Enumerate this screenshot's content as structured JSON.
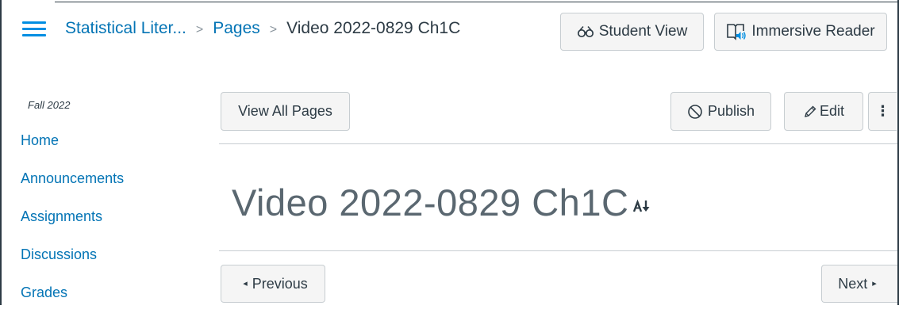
{
  "header": {
    "breadcrumbs": [
      {
        "label": "Statistical Liter...",
        "link": true
      },
      {
        "label": "Pages",
        "link": true
      },
      {
        "label": "Video 2022-0829 Ch1C",
        "link": false
      }
    ],
    "separator": ">",
    "student_view_label": "Student View",
    "student_view_icon": "glasses-icon",
    "immersive_reader_label": "Immersive Reader",
    "immersive_reader_icon": "immersive-reader-icon"
  },
  "sidebar": {
    "term": "Fall 2022",
    "items": [
      {
        "label": "Home"
      },
      {
        "label": "Announcements"
      },
      {
        "label": "Assignments"
      },
      {
        "label": "Discussions"
      },
      {
        "label": "Grades"
      }
    ]
  },
  "toolbar": {
    "view_all_label": "View All Pages",
    "publish_label": "Publish",
    "publish_icon": "unpublished-circle-icon",
    "edit_label": "Edit",
    "edit_icon": "pencil-icon",
    "more_icon": "kebab-menu-icon",
    "more_glyph": "⋮"
  },
  "page": {
    "title": "Video 2022-0829 Ch1C",
    "title_icon": "text-sort-icon"
  },
  "pager": {
    "previous_label": "Previous",
    "next_label": "Next",
    "previous_glyph": "◂",
    "next_glyph": "▸"
  },
  "colors": {
    "link": "#0374b5",
    "accent": "#008ee2",
    "text": "#2d3b45",
    "button_bg": "#f5f5f5",
    "border": "#c7cdd1"
  }
}
